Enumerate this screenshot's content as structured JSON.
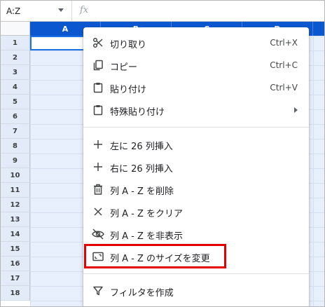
{
  "formula_bar": {
    "name_box": "A:Z",
    "fx_icon": "fx"
  },
  "columns": [
    "A",
    "B",
    "C",
    "D"
  ],
  "rows": [
    "1",
    "2",
    "3",
    "4",
    "5",
    "6",
    "7",
    "8",
    "9",
    "10",
    "11",
    "12",
    "13",
    "14",
    "15",
    "16",
    "17",
    "18"
  ],
  "menu": {
    "items": [
      {
        "icon": "scissors-icon",
        "label": "切り取り",
        "shortcut": "Ctrl+X"
      },
      {
        "icon": "copy-icon",
        "label": "コピー",
        "shortcut": "Ctrl+C"
      },
      {
        "icon": "clipboard-icon",
        "label": "貼り付け",
        "shortcut": "Ctrl+V"
      },
      {
        "icon": "clipboard-icon",
        "label": "特殊貼り付け",
        "submenu": true
      },
      {
        "icon": "plus-icon",
        "label": "左に 26 列挿入"
      },
      {
        "icon": "plus-icon",
        "label": "右に 26 列挿入"
      },
      {
        "icon": "trash-icon",
        "label": "列 A - Z を削除"
      },
      {
        "icon": "close-icon",
        "label": "列 A - Z をクリア"
      },
      {
        "icon": "eye-off-icon",
        "label": "列 A - Z を非表示"
      },
      {
        "icon": "resize-icon",
        "label": "列 A - Z のサイズを変更"
      },
      {
        "icon": "filter-icon",
        "label": "フィルタを作成"
      }
    ]
  },
  "colors": {
    "column_header_selected": "#0b57d0",
    "row_header_selected": "#e3ebf8",
    "highlight_box": "#e50000"
  }
}
